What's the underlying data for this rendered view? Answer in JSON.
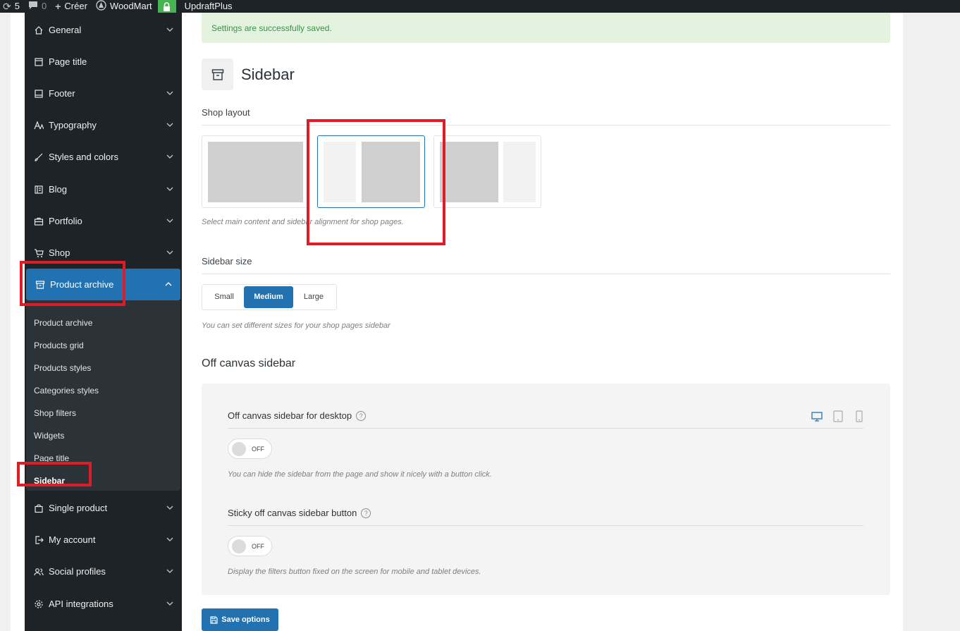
{
  "adminbar": {
    "updates_count": "5",
    "comments_count": "0",
    "create_label": "Créer",
    "theme_label": "WoodMart",
    "plugin_label": "UpdraftPlus"
  },
  "sidebar": {
    "items": [
      {
        "label": "General",
        "icon": "home-icon"
      },
      {
        "label": "Page title",
        "icon": "page-title-icon"
      },
      {
        "label": "Footer",
        "icon": "footer-icon"
      },
      {
        "label": "Typography",
        "icon": "typography-icon"
      },
      {
        "label": "Styles and colors",
        "icon": "brush-icon"
      },
      {
        "label": "Blog",
        "icon": "blog-icon"
      },
      {
        "label": "Portfolio",
        "icon": "briefcase-icon"
      },
      {
        "label": "Shop",
        "icon": "cart-icon"
      },
      {
        "label": "Product archive",
        "icon": "archive-icon"
      },
      {
        "label": "Single product",
        "icon": "bag-icon"
      },
      {
        "label": "My account",
        "icon": "login-icon"
      },
      {
        "label": "Social profiles",
        "icon": "users-icon"
      },
      {
        "label": "API integrations",
        "icon": "gear-icon"
      }
    ],
    "submenu": [
      "Product archive",
      "Products grid",
      "Products styles",
      "Categories styles",
      "Shop filters",
      "Widgets",
      "Page title",
      "Sidebar"
    ]
  },
  "notice": "Settings are successfully saved.",
  "page_title": "Sidebar",
  "shop_layout": {
    "label": "Shop layout",
    "description": "Select main content and sidebar alignment for shop pages.",
    "options": [
      "no-sidebar",
      "left-sidebar",
      "right-sidebar"
    ],
    "selected": "left-sidebar"
  },
  "sidebar_size": {
    "label": "Sidebar size",
    "options": [
      "Small",
      "Medium",
      "Large"
    ],
    "selected": "Medium",
    "description": "You can set different sizes for your shop pages sidebar"
  },
  "off_canvas": {
    "title": "Off canvas sidebar",
    "desktop": {
      "label": "Off canvas sidebar for desktop",
      "toggle": "OFF",
      "description": "You can hide the sidebar from the page and show it nicely with a button click."
    },
    "sticky": {
      "label": "Sticky off canvas sidebar button",
      "toggle": "OFF",
      "description": "Display the filters button fixed on the screen for mobile and tablet devices."
    }
  },
  "save_label": "Save options",
  "colors": {
    "accent": "#2271b1",
    "sidebar_bg": "#1d2327",
    "notice_bg": "#e4f3df",
    "annotation": "#e01b24"
  }
}
